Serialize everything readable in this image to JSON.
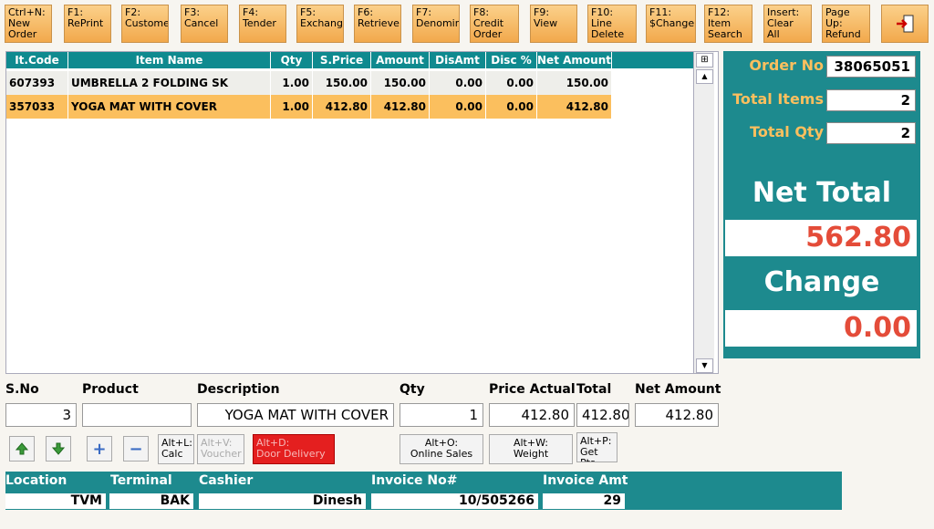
{
  "toolbar": {
    "keys": [
      {
        "label": "Ctrl+N:\nNew\nOrder"
      },
      {
        "label": "F1:\nRePrint"
      },
      {
        "label": "F2:\nCustome"
      },
      {
        "label": "F3:\nCancel"
      },
      {
        "label": "F4:\nTender"
      },
      {
        "label": "F5:\nExchang"
      },
      {
        "label": "F6:\nRetrieve"
      },
      {
        "label": "F7:\nDenomin"
      },
      {
        "label": "F8:\nCredit\nOrder"
      },
      {
        "label": "F9:\nView"
      },
      {
        "label": "F10:\nLine\nDelete"
      },
      {
        "label": "F11:\n$Change"
      },
      {
        "label": "F12:\nItem\nSearch"
      },
      {
        "label": "Insert:\nClear All"
      },
      {
        "label": "Page\nUp:\nRefund"
      }
    ],
    "exit_icon": "exit-door-icon"
  },
  "grid": {
    "columns": [
      "It.Code",
      "Item Name",
      "Qty",
      "S.Price",
      "Amount",
      "DisAmt",
      "Disc %",
      "Net Amount"
    ],
    "rows": [
      [
        "607393",
        "UMBRELLA 2 FOLDING SK",
        "1.00",
        "150.00",
        "150.00",
        "0.00",
        "0.00",
        "150.00"
      ],
      [
        "357033",
        "YOGA MAT WITH COVER",
        "1.00",
        "412.80",
        "412.80",
        "0.00",
        "0.00",
        "412.80"
      ]
    ],
    "selected_row": 1
  },
  "summary": {
    "order_no_label": "Order No",
    "order_no": "38065051",
    "total_items_label": "Total Items",
    "total_items": "2",
    "total_qty_label": "Total Qty",
    "total_qty": "2",
    "net_total_label": "Net Total",
    "net_total": "562.80",
    "change_label": "Change",
    "change": "0.00",
    "accent_color": "#1d8a8e",
    "value_color": "#e44c39"
  },
  "entry": {
    "sno_label": "S.No",
    "product_label": "Product",
    "description_label": "Description",
    "qty_label": "Qty",
    "price_label": "Price Actual",
    "total_label": "Total",
    "net_label": "Net Amount",
    "sno": "3",
    "product": "",
    "description": "YOGA MAT WITH COVER",
    "qty": "1",
    "price": "412.80",
    "total": "412.80",
    "net": "412.80"
  },
  "actions": {
    "up_icon": "arrow-up-icon",
    "down_icon": "arrow-down-icon",
    "plus_icon": "plus-icon",
    "minus_icon": "minus-icon",
    "calc": "Alt+L:\nCalc",
    "voucher": "Alt+V:\nVoucher",
    "door_delivery": "Alt+D:\nDoor Delivery",
    "online_sales": "Alt+O:\nOnline Sales",
    "weight": "Alt+W:\nWeight",
    "get_pts": "Alt+P:\nGet\nPts"
  },
  "status": {
    "location_label": "Location",
    "terminal_label": "Terminal",
    "cashier_label": "Cashier",
    "invoice_no_label": "Invoice No#",
    "invoice_amt_label": "Invoice Amt",
    "location": "TVM",
    "terminal": "BAK",
    "cashier": "Dinesh",
    "invoice_no": "10/505266",
    "invoice_amt": "29"
  }
}
